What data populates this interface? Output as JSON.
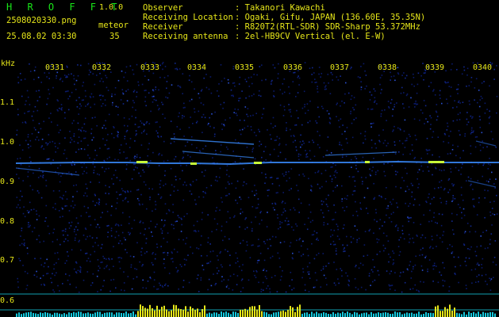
{
  "header": {
    "app_name": "H R O F F T",
    "app_version": "1.0.0",
    "file_name": "2508020330.png",
    "datetime": "25.08.02 03:30",
    "count_label": "meteor",
    "count_value": "35"
  },
  "station": {
    "observer_label": "Observer",
    "observer_value": ": Takanori Kawachi",
    "location_label": "Receiving Location",
    "location_value": ": Ogaki, Gifu, JAPAN (136.60E, 35.35N)",
    "receiver_label": "Receiver",
    "receiver_value": ": R820T2(RTL-SDR) SDR-Sharp 53.372MHz",
    "antenna_label": "Receiving antenna",
    "antenna_value": ": 2el-HB9CV Vertical (el. E-W)"
  },
  "axes": {
    "y_unit": "kHz",
    "x_ticks": [
      "0331",
      "0332",
      "0333",
      "0334",
      "0335",
      "0336",
      "0337",
      "0338",
      "0339",
      "0340"
    ],
    "y_ticks": [
      "1.1",
      "1.0",
      "0.9",
      "0.8",
      "0.7",
      "0.6"
    ]
  },
  "colors": {
    "text_green": "#19e619",
    "text_yellow": "#e6e619",
    "background": "#000000",
    "noise": "#0a1d8c",
    "signal": "#4aa8ff",
    "histogram": "#e6e619",
    "baseline": "#14c8dc"
  }
}
